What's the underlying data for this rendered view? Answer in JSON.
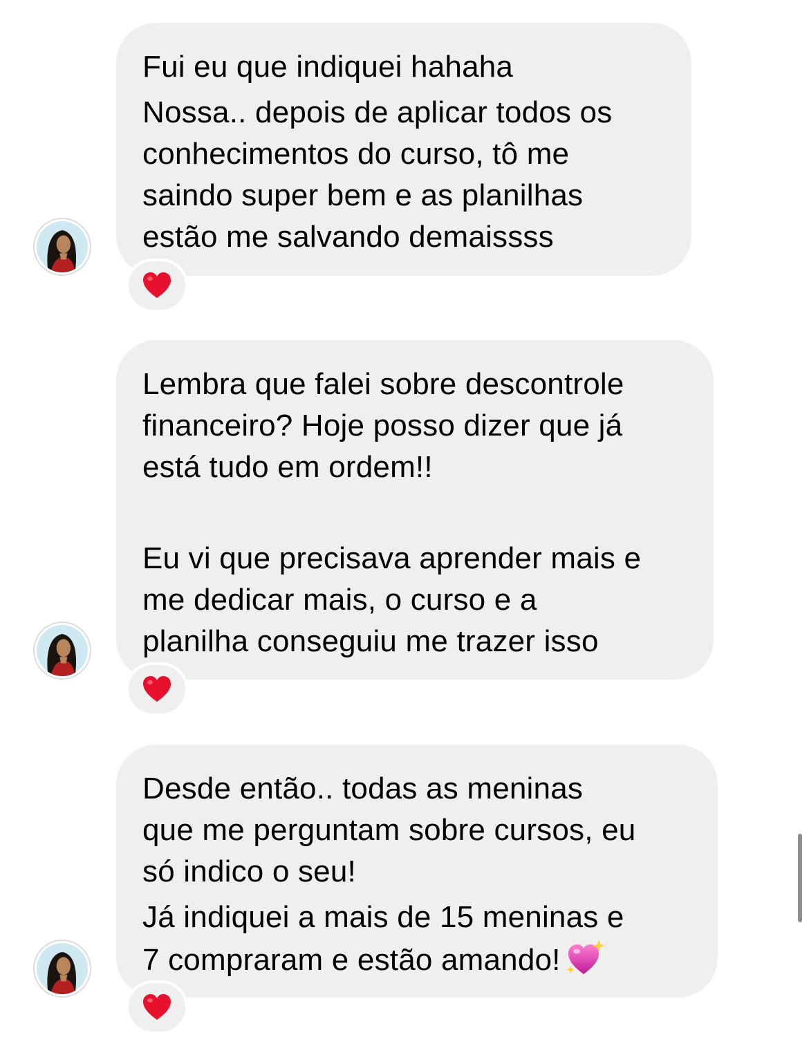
{
  "messages": [
    {
      "paragraphs": [
        [
          "Fui eu que indiquei hahaha"
        ],
        [
          "Nossa.. depois de aplicar todos os",
          "conhecimentos do curso, tô me",
          "saindo super bem e as planilhas",
          "estão me salvando demaissss"
        ]
      ],
      "reaction": "❤️"
    },
    {
      "paragraphs": [
        [
          "Lembra que falei sobre descontrole",
          "financeiro? Hoje posso dizer que já",
          "está tudo em ordem!!"
        ],
        [
          "Eu vi que precisava aprender mais e",
          "me dedicar mais, o curso e a",
          "planilha conseguiu me trazer isso"
        ]
      ],
      "reaction": "❤️"
    },
    {
      "paragraphs": [
        [
          "Desde então.. todas as meninas",
          "que me perguntam sobre cursos, eu",
          "só indico o seu!"
        ],
        [
          "Já indiquei a mais de 15 meninas e",
          "7 compraram e estão amando!"
        ]
      ],
      "trailing_emoji": "💖✨",
      "reaction": "❤️"
    }
  ],
  "colors": {
    "bubble_bg": "#efefef",
    "page_bg": "#ffffff",
    "heart": "#e8112d"
  },
  "icons": {
    "reaction": "red-heart-icon",
    "avatar": "sender-avatar"
  }
}
